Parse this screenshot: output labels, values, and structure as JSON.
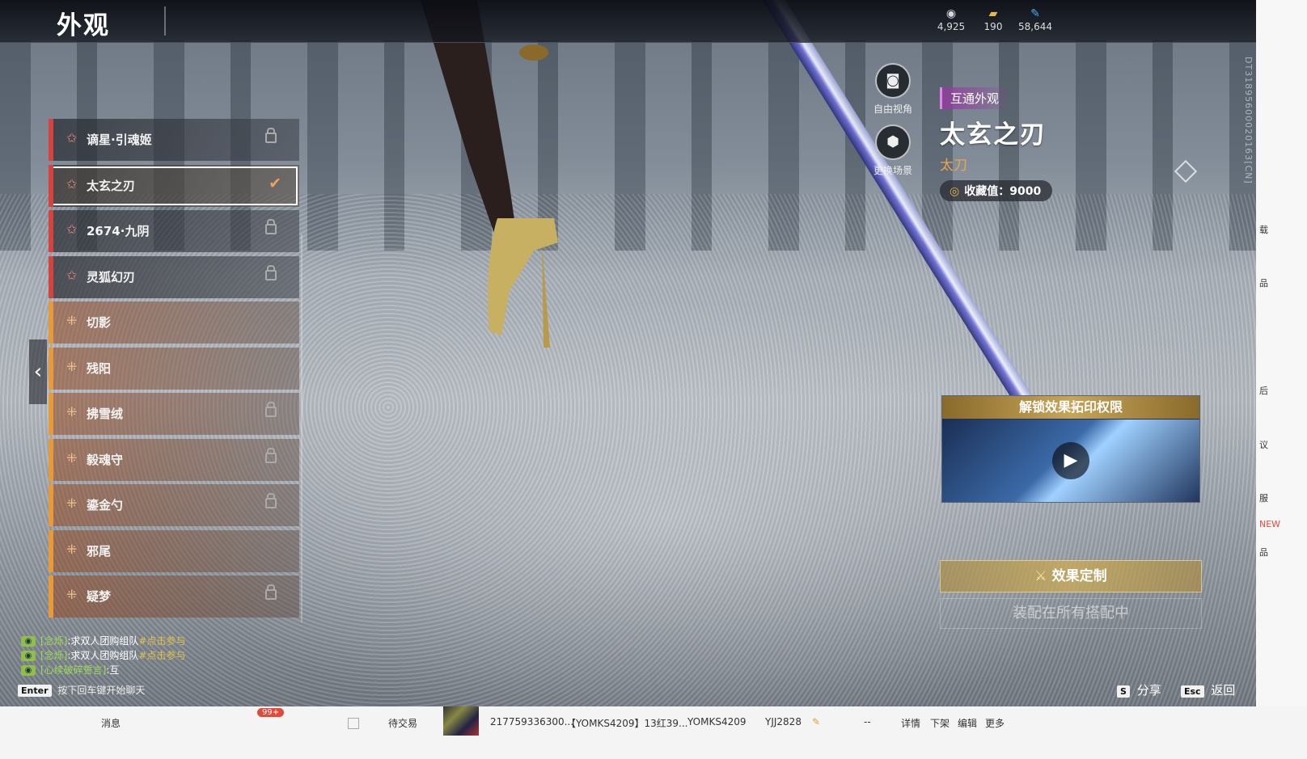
{
  "header": {
    "title": "外观",
    "currencies": [
      {
        "icon": "mask-icon",
        "value": "4,925"
      },
      {
        "icon": "gold-bar-icon",
        "value": "190"
      },
      {
        "icon": "feather-icon",
        "value": "58,644"
      }
    ]
  },
  "camera": {
    "free_view_label": "自由视角",
    "change_scene_label": "更换场景"
  },
  "list": {
    "items": [
      {
        "name": "谪星·引魂姬",
        "rarity": "red",
        "locked": true,
        "selected": false
      },
      {
        "name": "太玄之刃",
        "rarity": "red",
        "locked": false,
        "selected": true
      },
      {
        "name": "2674·九阴",
        "rarity": "red",
        "locked": true,
        "selected": false
      },
      {
        "name": "灵狐幻刃",
        "rarity": "red",
        "locked": true,
        "selected": false
      },
      {
        "name": "切影",
        "rarity": "orange",
        "locked": false,
        "selected": false
      },
      {
        "name": "残阳",
        "rarity": "orange",
        "locked": false,
        "selected": false
      },
      {
        "name": "拂雪绒",
        "rarity": "orange",
        "locked": true,
        "selected": false
      },
      {
        "name": "毅魂守",
        "rarity": "orange",
        "locked": true,
        "selected": false
      },
      {
        "name": "鎏金勺",
        "rarity": "orange",
        "locked": true,
        "selected": false
      },
      {
        "name": "邪尾",
        "rarity": "orange",
        "locked": false,
        "selected": false
      },
      {
        "name": "疑梦",
        "rarity": "orange",
        "locked": true,
        "selected": false
      }
    ]
  },
  "detail": {
    "tag": "互通外观",
    "name": "太玄之刃",
    "type": "太刀",
    "collect_value": "收藏值：9000",
    "unlock_title": "解锁效果拓印权限",
    "custom_button": "效果定制",
    "equip_status": "装配在所有搭配中"
  },
  "chat": {
    "messages": [
      {
        "sender": "[念烁]",
        "text": ":求双人团购组队",
        "link": "#点击参与"
      },
      {
        "sender": "[念烁]",
        "text": ":求双人团购组队",
        "link": "#点击参与"
      },
      {
        "sender": "[心续破碎誓言]",
        "text": ":互",
        "link": ""
      }
    ],
    "enter_key": "Enter",
    "hint": "按下回车键开始聊天"
  },
  "keys": {
    "share_key": "S",
    "share_label": "分享",
    "back_key": "Esc",
    "back_label": "返回"
  },
  "side_code": "DT31895600020163[CN]",
  "web_strip": {
    "left_label": "消息",
    "badge": "99+",
    "status": "待交易",
    "order": "217759336300...",
    "product": "【YOMKS4209】13红39...",
    "seller": "YOMKS4209",
    "buyer": "YJJ2828",
    "dash": "--",
    "actions": [
      "详情",
      "下架",
      "编辑",
      "更多"
    ]
  },
  "right_strip": [
    "载",
    "品",
    "后",
    "议",
    "服",
    "NEW",
    "品"
  ]
}
